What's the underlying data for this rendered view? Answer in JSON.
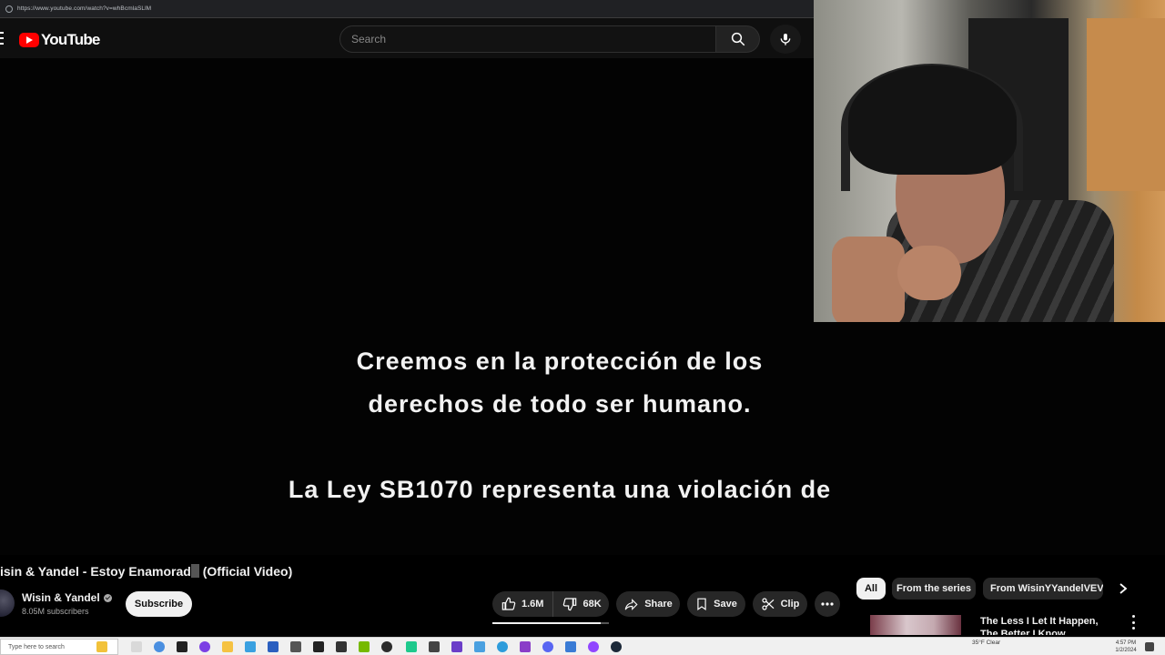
{
  "browser": {
    "url": "https://www.youtube.com/watch?v=whBcmlaSLlM"
  },
  "header": {
    "logo_text": "YouTube",
    "search_placeholder": "Search"
  },
  "video": {
    "captions": [
      "Creemos en la protección de los",
      "derechos de todo ser humano.",
      "La Ley SB1070 representa una violación de"
    ]
  },
  "info": {
    "title_before_cursor": "isin & Yandel - Estoy Enamorad",
    "title_after_cursor": " (Official Video)",
    "channel_name": "Wisin & Yandel",
    "subscribers": "8.05M subscribers",
    "subscribe_label": "Subscribe",
    "likes": "1.6M",
    "like_ratio": 0.93,
    "dislikes": "68K",
    "share_label": "Share",
    "save_label": "Save",
    "clip_label": "Clip"
  },
  "sidebar": {
    "chips": [
      "All",
      "From the series",
      "From WisinYYandelVEVO"
    ],
    "recommendation_title": "The Less I Let It Happen, The Better I Know"
  },
  "taskbar": {
    "search_placeholder": "Type here to search",
    "weather": "35°F Clear",
    "time": "4:57 PM",
    "date": "1/2/2024"
  },
  "colors": {
    "youtube_red": "#ff0000",
    "background": "#0f0f0f",
    "button_bg": "#272727"
  }
}
